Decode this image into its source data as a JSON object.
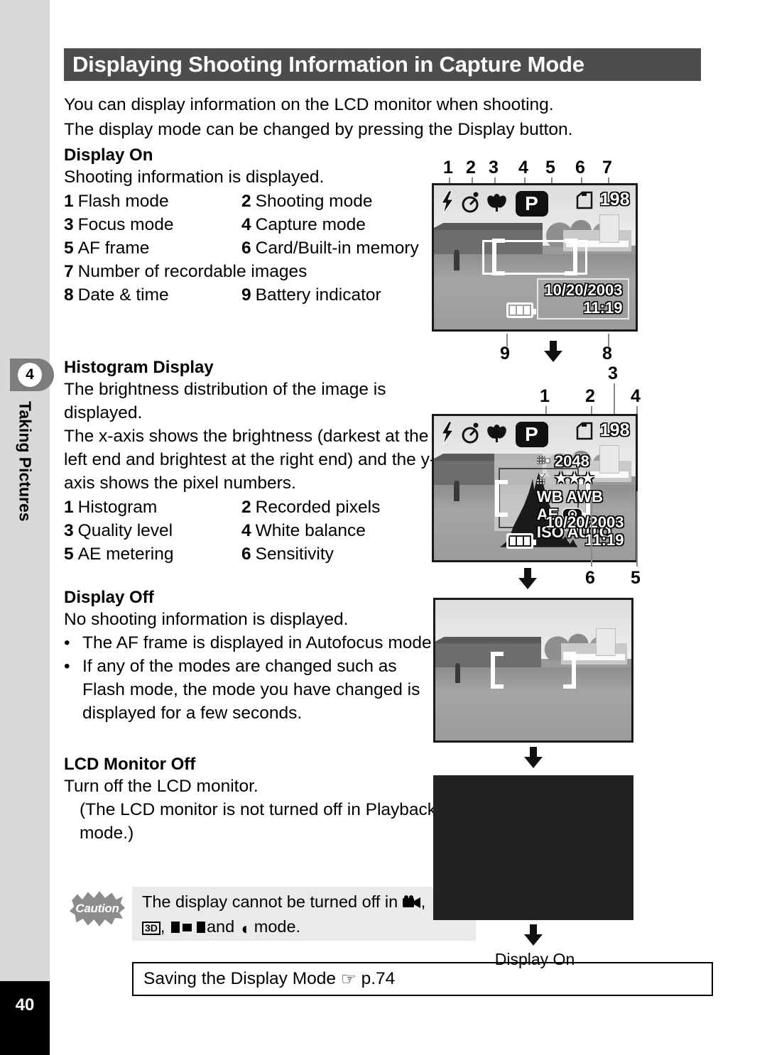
{
  "sidebar": {
    "chapter_number": "4",
    "chapter_label": "Taking Pictures",
    "page_number": "40"
  },
  "page_title": "Displaying Shooting Information in Capture Mode",
  "intro": {
    "line1": "You can display information on the LCD monitor when shooting.",
    "line2": "The display mode can be changed by pressing the Display button."
  },
  "display_on": {
    "heading": "Display On",
    "description": "Shooting information is displayed.",
    "items": [
      {
        "n": "1",
        "label": "Flash mode"
      },
      {
        "n": "2",
        "label": "Shooting mode"
      },
      {
        "n": "3",
        "label": "Focus mode"
      },
      {
        "n": "4",
        "label": "Capture mode"
      },
      {
        "n": "5",
        "label": "AF frame"
      },
      {
        "n": "6",
        "label": "Card/Built-in memory"
      },
      {
        "n": "7",
        "label": "Number of recordable images"
      },
      {
        "n": "8",
        "label": "Date & time"
      },
      {
        "n": "9",
        "label": "Battery indicator"
      }
    ]
  },
  "histogram_display": {
    "heading": "Histogram Display",
    "description_line1": "The brightness distribution of the image is",
    "description_line2": "displayed.",
    "description_line3": "The x-axis shows the brightness (darkest at the",
    "description_line4": "left end and brightest at the right end) and the y-",
    "description_line5": "axis shows the pixel numbers.",
    "items": [
      {
        "n": "1",
        "label": "Histogram"
      },
      {
        "n": "2",
        "label": "Recorded pixels"
      },
      {
        "n": "3",
        "label": "Quality level"
      },
      {
        "n": "4",
        "label": "White balance"
      },
      {
        "n": "5",
        "label": "AE metering"
      },
      {
        "n": "6",
        "label": "Sensitivity"
      }
    ]
  },
  "display_off": {
    "heading": "Display Off",
    "description": "No shooting information is displayed.",
    "bullet1": "The AF frame is displayed in Autofocus mode.",
    "bullet2_line1": "If any of the modes are changed such as",
    "bullet2_line2": "Flash mode, the mode you have changed is",
    "bullet2_line3": "displayed for a few seconds."
  },
  "lcd_monitor_off": {
    "heading": "LCD Monitor Off",
    "description": "Turn off the LCD monitor.",
    "note_line1": "(The LCD monitor is not turned off in Playback",
    "note_line2": "mode.)"
  },
  "caution": {
    "badge": "Caution",
    "text_part1": "The display cannot be turned off in",
    "text_part2": ",",
    "text_part3": ",",
    "icon_3d": "3D",
    "text_part4": "and",
    "text_part5": "mode."
  },
  "see_also": {
    "text_before": "Saving the Display Mode",
    "pointer_icon": "☞",
    "page_ref": "p.74"
  },
  "figures": {
    "lcd1": {
      "callouts_top": [
        "1",
        "2",
        "3",
        "4",
        "5",
        "6",
        "7"
      ],
      "callouts_bottom": [
        "9",
        "8"
      ],
      "rec_count": "198",
      "date": "10/20/2003",
      "time": "11:19",
      "mode_badge": "P",
      "icons": [
        "flash-icon",
        "self-timer-icon",
        "macro-icon",
        "program-mode-icon",
        "af-frame-icon",
        "card-icon",
        "battery-icon"
      ]
    },
    "lcd2": {
      "callouts": [
        "1",
        "2",
        "3",
        "4",
        "5",
        "6"
      ],
      "rec_count": "198",
      "mode_badge": "P",
      "recorded_pixels": "2048",
      "quality": "★★★",
      "wb_label": "WB",
      "wb_value": "AWB",
      "ae_label": "AE",
      "iso_label": "ISO",
      "iso_value": "AUTO",
      "date": "10/20/2003",
      "time": "11:19"
    },
    "lcd3": {
      "af_frame": "af-frame-icon"
    },
    "lcd4": {
      "state": "blank-black-screen"
    },
    "bottom_caption": "Display On"
  }
}
